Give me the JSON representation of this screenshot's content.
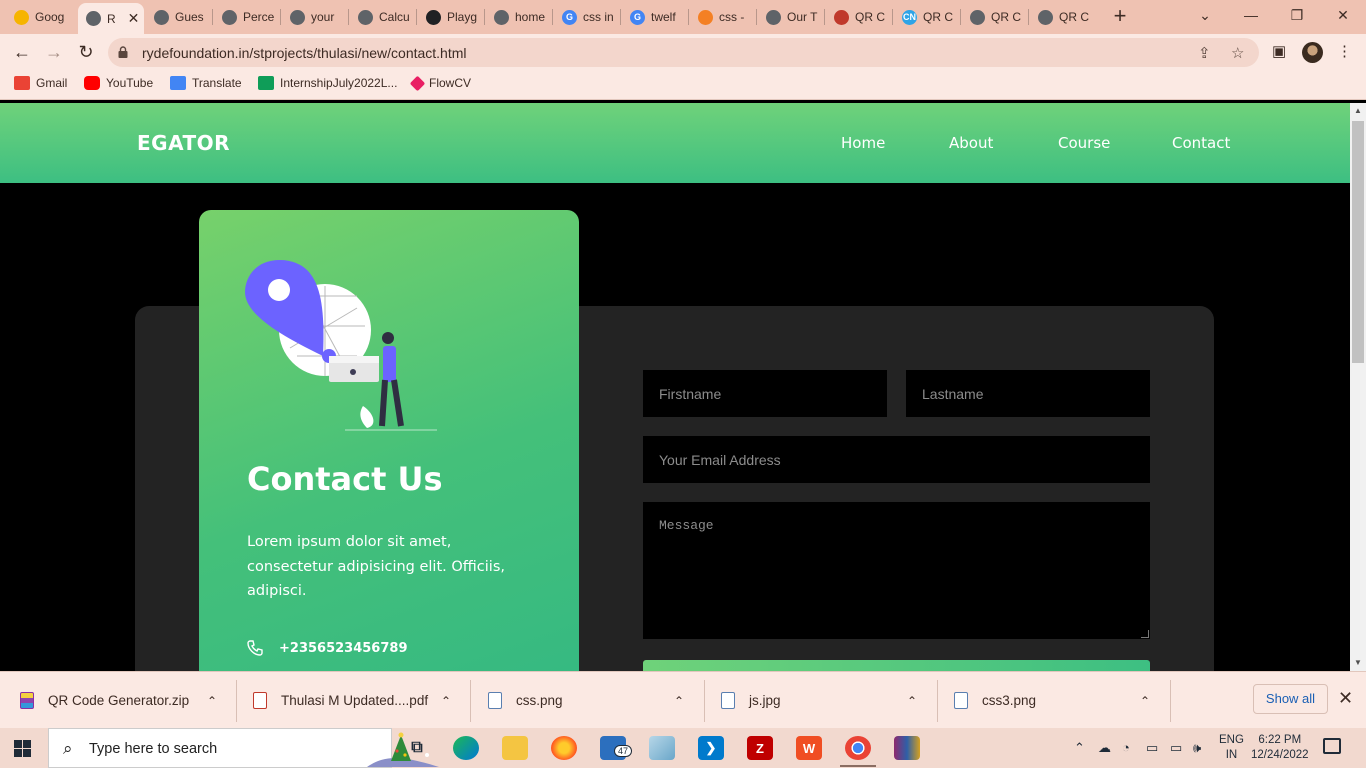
{
  "browser": {
    "tabs": [
      {
        "label": "Goog",
        "color": "#f6b400"
      },
      {
        "label": "R",
        "color": "#5f6368",
        "active": true
      },
      {
        "label": "Gues",
        "color": "#5f6368"
      },
      {
        "label": "Perce",
        "color": "#5f6368"
      },
      {
        "label": "your",
        "color": "#5f6368"
      },
      {
        "label": "Calcu",
        "color": "#5f6368"
      },
      {
        "label": "Playg",
        "color": "#202124"
      },
      {
        "label": "home",
        "color": "#5f6368"
      },
      {
        "label": "css in",
        "color": "#4285f4"
      },
      {
        "label": "twelf",
        "color": "#4285f4"
      },
      {
        "label": "css -",
        "color": "#f48024"
      },
      {
        "label": "Our T",
        "color": "#5f6368"
      },
      {
        "label": "QR C",
        "color": "#c0392b"
      },
      {
        "label": "QR C",
        "color": "#2fa4e7"
      },
      {
        "label": "QR C",
        "color": "#5f6368"
      },
      {
        "label": "QR C",
        "color": "#5f6368"
      }
    ],
    "url": "rydefoundation.in/stprojects/thulasi/new/contact.html",
    "bookmarks": [
      {
        "label": "Gmail",
        "color": "#ea4335"
      },
      {
        "label": "YouTube",
        "color": "#ff0000"
      },
      {
        "label": "Translate",
        "color": "#4285f4"
      },
      {
        "label": "InternshipJuly2022L...",
        "color": "#0f9d58"
      },
      {
        "label": "FlowCV",
        "color": "#e91e63"
      }
    ]
  },
  "site": {
    "brand": "EGATOR",
    "nav": [
      "Home",
      "About",
      "Course",
      "Contact"
    ],
    "contact_card": {
      "title": "Contact Us",
      "text": "Lorem ipsum dolor sit amet, consectetur adipisicing elit. Officiis, adipisci.",
      "phone": "+2356523456789"
    },
    "form": {
      "firstname_placeholder": "Firstname",
      "lastname_placeholder": "Lastname",
      "email_placeholder": "Your Email Address",
      "message_placeholder": "Message"
    },
    "colors": {
      "green_light": "#6fd27a",
      "green_dark": "#3dbf82",
      "panel": "#232323"
    }
  },
  "downloads": {
    "items": [
      {
        "name": "QR Code Generator.zip"
      },
      {
        "name": "Thulasi M Updated....pdf"
      },
      {
        "name": "css.png"
      },
      {
        "name": "js.jpg"
      },
      {
        "name": "css3.png"
      }
    ],
    "show_all": "Show all"
  },
  "taskbar": {
    "search_placeholder": "Type here to search",
    "mail_badge": "47",
    "lang_1": "ENG",
    "lang_2": "IN",
    "time": "6:22 PM",
    "date": "12/24/2022"
  }
}
